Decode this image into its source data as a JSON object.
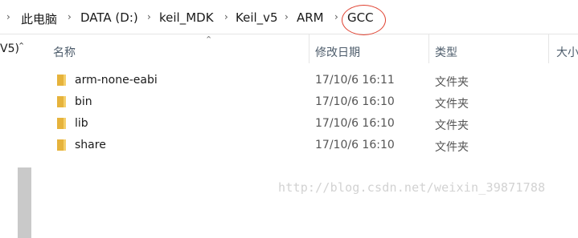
{
  "breadcrumb": {
    "items": [
      "此电脑",
      "DATA (D:)",
      "keil_MDK",
      "Keil_v5",
      "ARM",
      "GCC"
    ]
  },
  "nav_pane": {
    "truncated_label": "V5)"
  },
  "columns": {
    "name": "名称",
    "date_modified": "修改日期",
    "type": "类型",
    "size": "大小"
  },
  "files": [
    {
      "name": "arm-none-eabi",
      "date": "17/10/6 16:11",
      "type": "文件夹"
    },
    {
      "name": "bin",
      "date": "17/10/6 16:10",
      "type": "文件夹"
    },
    {
      "name": "lib",
      "date": "17/10/6 16:10",
      "type": "文件夹"
    },
    {
      "name": "share",
      "date": "17/10/6 16:10",
      "type": "文件夹"
    }
  ],
  "watermark": "http://blog.csdn.net/weixin_39871788",
  "colors": {
    "annotation_circle": "#e0402f",
    "folder": "#e6b33c"
  },
  "icons": {
    "separator": "chevron-right-icon",
    "sort": "sort-ascending-icon",
    "folder": "folder-icon"
  }
}
